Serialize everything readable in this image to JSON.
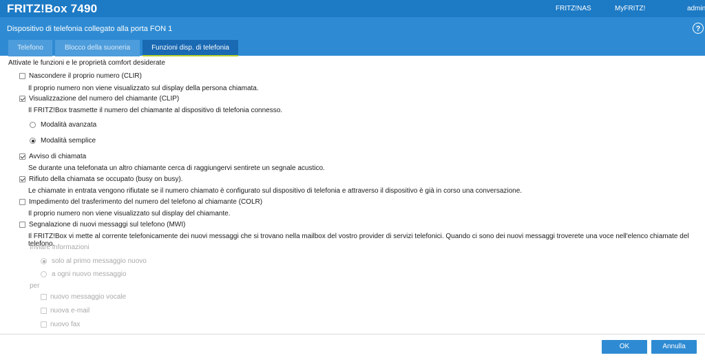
{
  "header": {
    "brand": "FRITZ!Box 7490",
    "links": [
      "FRITZ!NAS",
      "MyFRITZ!",
      "admin"
    ]
  },
  "page": {
    "title": "Dispositivo di telefonia collegato alla porta FON 1",
    "help": "?"
  },
  "tabs": [
    {
      "label": "Telefono",
      "active": false
    },
    {
      "label": "Blocco della suoneria",
      "active": false
    },
    {
      "label": "Funzioni disp. di telefonia",
      "active": true
    }
  ],
  "content": {
    "intro": "Attivate le funzioni e le proprietà comfort desiderate",
    "clir": {
      "label": "Nascondere il proprio numero (CLIR)",
      "checked": false,
      "desc": "Il proprio numero non viene visualizzato sul display della persona chiamata."
    },
    "clip": {
      "label": "Visualizzazione del numero del chiamante (CLIP)",
      "checked": true,
      "desc": "Il FRITZ!Box trasmette il numero del chiamante al dispositivo di telefonia connesso.",
      "modes": [
        {
          "label": "Modalità avanzata",
          "selected": false
        },
        {
          "label": "Modalità semplice",
          "selected": true
        }
      ]
    },
    "call_waiting": {
      "label": "Avviso di chiamata",
      "checked": true,
      "desc": "Se durante una telefonata un altro chiamante cerca di raggiungervi sentirete un segnale acustico."
    },
    "busy_on_busy": {
      "label": "Rifiuto della chiamata se occupato (busy on busy).",
      "checked": true,
      "desc": "Le chiamate in entrata vengono rifiutate se il numero chiamato è configurato sul dispositivo di telefonia e attraverso il dispositivo è già in corso una conversazione."
    },
    "colr": {
      "label": "Impedimento del trasferimento del numero del telefono al chiamante (COLR)",
      "checked": false,
      "desc": "Il proprio numero non viene visualizzato sul display del chiamante."
    },
    "mwi": {
      "label": "Segnalazione di nuovi messaggi sul telefono (MWI)",
      "checked": false,
      "desc": "Il FRITZ!Box vi mette al corrente telefonicamente dei nuovi messaggi che si trovano nella mailbox del vostro provider di servizi telefonici. Quando ci sono dei nuovi messaggi troverete una voce nell'elenco chiamate del telefono.",
      "send_info_label": "Inviare informazioni",
      "send_options": [
        {
          "label": "solo al primo messaggio nuovo",
          "selected": true
        },
        {
          "label": "a ogni nuovo messaggio",
          "selected": false
        }
      ],
      "per_label": "per",
      "per_options": [
        {
          "label": "nuovo messaggio vocale",
          "checked": false
        },
        {
          "label": "nuova e-mail",
          "checked": false
        },
        {
          "label": "nuovo fax",
          "checked": false
        }
      ]
    }
  },
  "footer": {
    "ok_label": "OK",
    "cancel_label": "Annulla"
  },
  "colors": {
    "header_bg": "#1d7ac5",
    "titlebar_bg": "#2e8bd3",
    "tab_active_underline": "#b5cf2b",
    "button_bg": "#2e8bd3"
  }
}
